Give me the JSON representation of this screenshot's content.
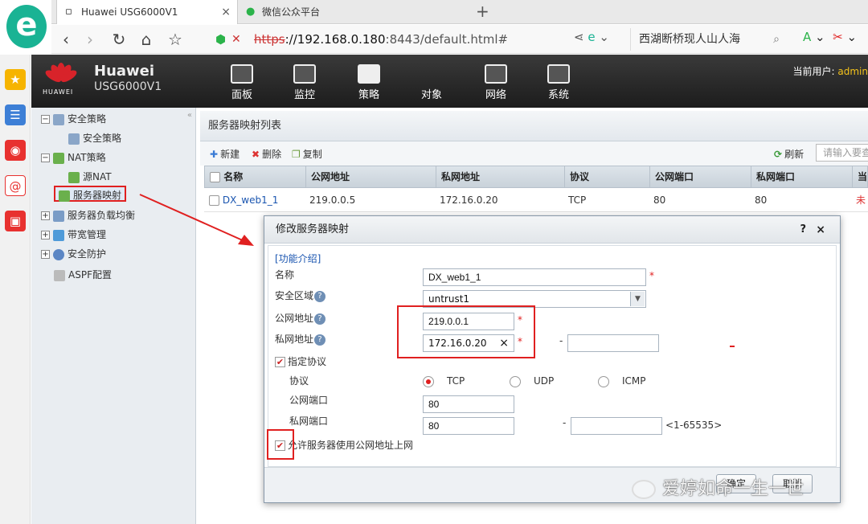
{
  "browser": {
    "tabs": [
      {
        "title": "Huawei USG6000V1",
        "close": "×"
      },
      {
        "title": "微信公众平台"
      }
    ],
    "new_tab": "+",
    "url_scheme": "https",
    "url_host": "://192.168.0.180",
    "url_rest": ":8443/default.html#",
    "search_text": "西湖断桥现人山人海"
  },
  "header": {
    "brand_small": "HUAWEI",
    "brand_name": "Huawei",
    "model": "USG6000V1",
    "menu": [
      "面板",
      "监控",
      "策略",
      "对象",
      "网络",
      "系统"
    ],
    "current_user_label": "当前用户:",
    "current_user": "admin"
  },
  "tree": {
    "items": [
      {
        "label": "安全策略"
      },
      {
        "label": "安全策略"
      },
      {
        "label": "NAT策略"
      },
      {
        "label": "源NAT"
      },
      {
        "label": "服务器映射"
      },
      {
        "label": "服务器负载均衡"
      },
      {
        "label": "带宽管理"
      },
      {
        "label": "安全防护"
      },
      {
        "label": "ASPF配置"
      }
    ]
  },
  "list": {
    "title": "服务器映射列表",
    "toolbar": {
      "new": "新建",
      "delete": "删除",
      "copy": "复制",
      "refresh": "刷新",
      "search_placeholder": "请输入要查"
    },
    "columns": [
      "名称",
      "公网地址",
      "私网地址",
      "协议",
      "公网端口",
      "私网端口",
      "当前"
    ],
    "rows": [
      {
        "name": "DX_web1_1",
        "public_ip": "219.0.0.5",
        "private_ip": "172.16.0.20",
        "protocol": "TCP",
        "public_port": "80",
        "private_port": "80",
        "status": "未"
      }
    ]
  },
  "dialog": {
    "title": "修改服务器映射",
    "help": "?",
    "close": "×",
    "intro_link": "[功能介绍]",
    "labels": {
      "name": "名称",
      "zone": "安全区域",
      "public_ip": "公网地址",
      "private_ip": "私网地址",
      "specify_protocol": "指定协议",
      "protocol": "协议",
      "public_port": "公网端口",
      "private_port": "私网端口",
      "allow_public": "允许服务器使用公网地址上网"
    },
    "values": {
      "name": "DX_web1_1",
      "zone": "untrust1",
      "public_ip": "219.0.0.1",
      "private_ip": "172.16.0.20",
      "public_port": "80",
      "private_port": "80",
      "port_range": "<1-65535>"
    },
    "protocol_options": [
      "TCP",
      "UDP",
      "ICMP"
    ],
    "selected_protocol": "TCP",
    "required_mark": "*",
    "dash": "-",
    "clear_icon": "×",
    "buttons": {
      "ok": "确定",
      "cancel": "取消"
    }
  },
  "watermark": "爱婷如命一生一世",
  "colors": {
    "accent_red": "#e02020",
    "header_bg": "#2a2a2a",
    "brand_red": "#d8232a",
    "user_yellow": "#f3c21b"
  }
}
